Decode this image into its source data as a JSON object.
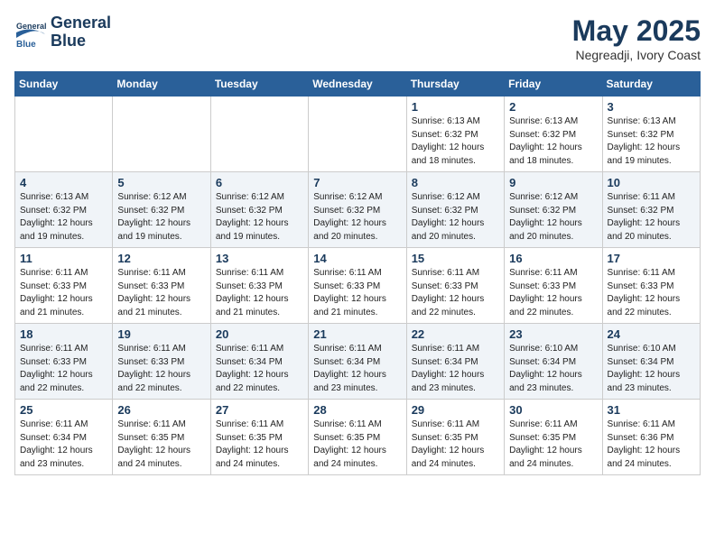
{
  "header": {
    "logo_line1": "General",
    "logo_line2": "Blue",
    "month_year": "May 2025",
    "location": "Negreadji, Ivory Coast"
  },
  "weekdays": [
    "Sunday",
    "Monday",
    "Tuesday",
    "Wednesday",
    "Thursday",
    "Friday",
    "Saturday"
  ],
  "weeks": [
    [
      {
        "day": "",
        "info": ""
      },
      {
        "day": "",
        "info": ""
      },
      {
        "day": "",
        "info": ""
      },
      {
        "day": "",
        "info": ""
      },
      {
        "day": "1",
        "info": "Sunrise: 6:13 AM\nSunset: 6:32 PM\nDaylight: 12 hours\nand 18 minutes."
      },
      {
        "day": "2",
        "info": "Sunrise: 6:13 AM\nSunset: 6:32 PM\nDaylight: 12 hours\nand 18 minutes."
      },
      {
        "day": "3",
        "info": "Sunrise: 6:13 AM\nSunset: 6:32 PM\nDaylight: 12 hours\nand 19 minutes."
      }
    ],
    [
      {
        "day": "4",
        "info": "Sunrise: 6:13 AM\nSunset: 6:32 PM\nDaylight: 12 hours\nand 19 minutes."
      },
      {
        "day": "5",
        "info": "Sunrise: 6:12 AM\nSunset: 6:32 PM\nDaylight: 12 hours\nand 19 minutes."
      },
      {
        "day": "6",
        "info": "Sunrise: 6:12 AM\nSunset: 6:32 PM\nDaylight: 12 hours\nand 19 minutes."
      },
      {
        "day": "7",
        "info": "Sunrise: 6:12 AM\nSunset: 6:32 PM\nDaylight: 12 hours\nand 20 minutes."
      },
      {
        "day": "8",
        "info": "Sunrise: 6:12 AM\nSunset: 6:32 PM\nDaylight: 12 hours\nand 20 minutes."
      },
      {
        "day": "9",
        "info": "Sunrise: 6:12 AM\nSunset: 6:32 PM\nDaylight: 12 hours\nand 20 minutes."
      },
      {
        "day": "10",
        "info": "Sunrise: 6:11 AM\nSunset: 6:32 PM\nDaylight: 12 hours\nand 20 minutes."
      }
    ],
    [
      {
        "day": "11",
        "info": "Sunrise: 6:11 AM\nSunset: 6:33 PM\nDaylight: 12 hours\nand 21 minutes."
      },
      {
        "day": "12",
        "info": "Sunrise: 6:11 AM\nSunset: 6:33 PM\nDaylight: 12 hours\nand 21 minutes."
      },
      {
        "day": "13",
        "info": "Sunrise: 6:11 AM\nSunset: 6:33 PM\nDaylight: 12 hours\nand 21 minutes."
      },
      {
        "day": "14",
        "info": "Sunrise: 6:11 AM\nSunset: 6:33 PM\nDaylight: 12 hours\nand 21 minutes."
      },
      {
        "day": "15",
        "info": "Sunrise: 6:11 AM\nSunset: 6:33 PM\nDaylight: 12 hours\nand 22 minutes."
      },
      {
        "day": "16",
        "info": "Sunrise: 6:11 AM\nSunset: 6:33 PM\nDaylight: 12 hours\nand 22 minutes."
      },
      {
        "day": "17",
        "info": "Sunrise: 6:11 AM\nSunset: 6:33 PM\nDaylight: 12 hours\nand 22 minutes."
      }
    ],
    [
      {
        "day": "18",
        "info": "Sunrise: 6:11 AM\nSunset: 6:33 PM\nDaylight: 12 hours\nand 22 minutes."
      },
      {
        "day": "19",
        "info": "Sunrise: 6:11 AM\nSunset: 6:33 PM\nDaylight: 12 hours\nand 22 minutes."
      },
      {
        "day": "20",
        "info": "Sunrise: 6:11 AM\nSunset: 6:34 PM\nDaylight: 12 hours\nand 22 minutes."
      },
      {
        "day": "21",
        "info": "Sunrise: 6:11 AM\nSunset: 6:34 PM\nDaylight: 12 hours\nand 23 minutes."
      },
      {
        "day": "22",
        "info": "Sunrise: 6:11 AM\nSunset: 6:34 PM\nDaylight: 12 hours\nand 23 minutes."
      },
      {
        "day": "23",
        "info": "Sunrise: 6:10 AM\nSunset: 6:34 PM\nDaylight: 12 hours\nand 23 minutes."
      },
      {
        "day": "24",
        "info": "Sunrise: 6:10 AM\nSunset: 6:34 PM\nDaylight: 12 hours\nand 23 minutes."
      }
    ],
    [
      {
        "day": "25",
        "info": "Sunrise: 6:11 AM\nSunset: 6:34 PM\nDaylight: 12 hours\nand 23 minutes."
      },
      {
        "day": "26",
        "info": "Sunrise: 6:11 AM\nSunset: 6:35 PM\nDaylight: 12 hours\nand 24 minutes."
      },
      {
        "day": "27",
        "info": "Sunrise: 6:11 AM\nSunset: 6:35 PM\nDaylight: 12 hours\nand 24 minutes."
      },
      {
        "day": "28",
        "info": "Sunrise: 6:11 AM\nSunset: 6:35 PM\nDaylight: 12 hours\nand 24 minutes."
      },
      {
        "day": "29",
        "info": "Sunrise: 6:11 AM\nSunset: 6:35 PM\nDaylight: 12 hours\nand 24 minutes."
      },
      {
        "day": "30",
        "info": "Sunrise: 6:11 AM\nSunset: 6:35 PM\nDaylight: 12 hours\nand 24 minutes."
      },
      {
        "day": "31",
        "info": "Sunrise: 6:11 AM\nSunset: 6:36 PM\nDaylight: 12 hours\nand 24 minutes."
      }
    ]
  ]
}
